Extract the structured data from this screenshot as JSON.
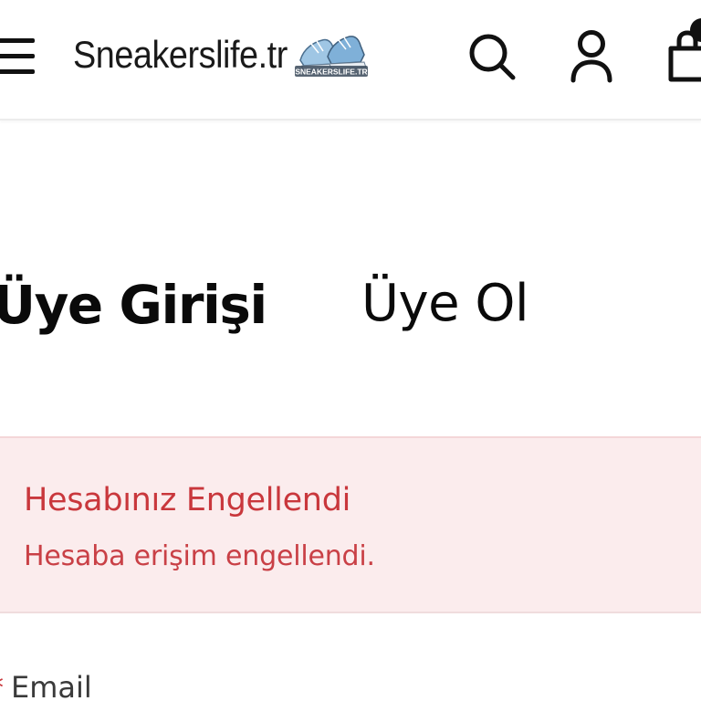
{
  "header": {
    "brand_text": "Sneakerslife.tr",
    "logo_text": "SNEAKERSLIFE.TR",
    "icons": {
      "menu": "menu-icon",
      "search": "search-icon",
      "account": "user-icon",
      "cart": "shopping-bag-icon"
    }
  },
  "tabs": [
    {
      "label": "Üye Girişi",
      "active": true
    },
    {
      "label": "Üye Ol",
      "active": false
    }
  ],
  "alert": {
    "title": "Hesabınız Engellendi",
    "message": "Hesaba erişim engellendi."
  },
  "form": {
    "email_label": "Email"
  },
  "colors": {
    "alert_background": "#fbeced",
    "alert_text": "#c9373c",
    "text_primary": "#0a0a0a"
  }
}
